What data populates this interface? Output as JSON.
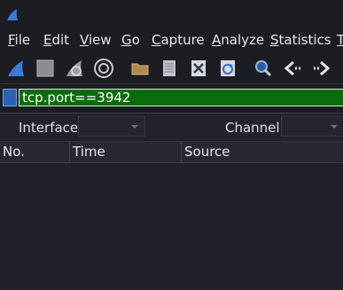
{
  "app": {
    "icon": "wireshark-fin-icon"
  },
  "menu": {
    "items": [
      {
        "label": "File",
        "underline": "F",
        "rest": "ile"
      },
      {
        "label": "Edit",
        "underline": "E",
        "rest": "dit"
      },
      {
        "label": "View",
        "underline": "V",
        "rest": "iew"
      },
      {
        "label": "Go",
        "underline": "G",
        "rest": "o"
      },
      {
        "label": "Capture",
        "underline": "C",
        "rest": "apture"
      },
      {
        "label": "Analyze",
        "underline": "A",
        "rest": "nalyze"
      },
      {
        "label": "Statistics",
        "underline": "S",
        "rest": "tatistics"
      },
      {
        "label": "T",
        "underline": "T",
        "rest": ""
      }
    ]
  },
  "toolbar": {
    "buttons": [
      "start-capture-fin-icon",
      "stop-capture-icon",
      "restart-capture-icon",
      "capture-options-gear-icon",
      "open-file-folder-icon",
      "save-file-icon",
      "close-file-icon",
      "reload-file-icon",
      "find-packet-search-icon",
      "go-back-arrow-icon",
      "go-forward-arrow-icon"
    ]
  },
  "filter": {
    "value": "tcp.port==3942",
    "bg_color": "#0b6b0b"
  },
  "wireless": {
    "interface_label": "Interface",
    "interface_value": "",
    "channel_label": "Channel",
    "channel_value": ""
  },
  "packet_list": {
    "columns": [
      "No.",
      "Time",
      "Source"
    ],
    "rows": []
  }
}
